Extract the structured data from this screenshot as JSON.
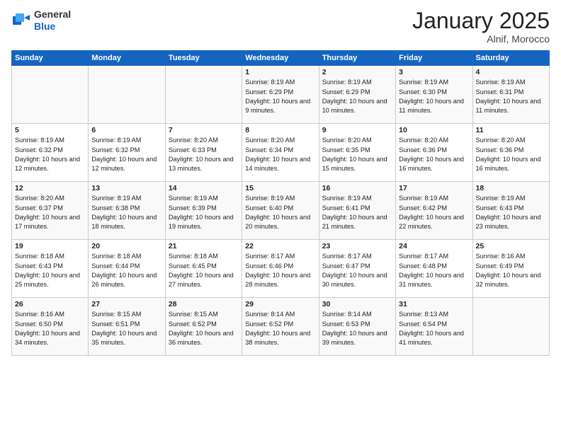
{
  "header": {
    "logo_general": "General",
    "logo_blue": "Blue",
    "month_title": "January 2025",
    "location": "Alnif, Morocco"
  },
  "days_of_week": [
    "Sunday",
    "Monday",
    "Tuesday",
    "Wednesday",
    "Thursday",
    "Friday",
    "Saturday"
  ],
  "weeks": [
    [
      {
        "day": "",
        "info": ""
      },
      {
        "day": "",
        "info": ""
      },
      {
        "day": "",
        "info": ""
      },
      {
        "day": "1",
        "info": "Sunrise: 8:19 AM\nSunset: 6:29 PM\nDaylight: 10 hours and 9 minutes."
      },
      {
        "day": "2",
        "info": "Sunrise: 8:19 AM\nSunset: 6:29 PM\nDaylight: 10 hours and 10 minutes."
      },
      {
        "day": "3",
        "info": "Sunrise: 8:19 AM\nSunset: 6:30 PM\nDaylight: 10 hours and 11 minutes."
      },
      {
        "day": "4",
        "info": "Sunrise: 8:19 AM\nSunset: 6:31 PM\nDaylight: 10 hours and 11 minutes."
      }
    ],
    [
      {
        "day": "5",
        "info": "Sunrise: 8:19 AM\nSunset: 6:32 PM\nDaylight: 10 hours and 12 minutes."
      },
      {
        "day": "6",
        "info": "Sunrise: 8:19 AM\nSunset: 6:32 PM\nDaylight: 10 hours and 12 minutes."
      },
      {
        "day": "7",
        "info": "Sunrise: 8:20 AM\nSunset: 6:33 PM\nDaylight: 10 hours and 13 minutes."
      },
      {
        "day": "8",
        "info": "Sunrise: 8:20 AM\nSunset: 6:34 PM\nDaylight: 10 hours and 14 minutes."
      },
      {
        "day": "9",
        "info": "Sunrise: 8:20 AM\nSunset: 6:35 PM\nDaylight: 10 hours and 15 minutes."
      },
      {
        "day": "10",
        "info": "Sunrise: 8:20 AM\nSunset: 6:36 PM\nDaylight: 10 hours and 16 minutes."
      },
      {
        "day": "11",
        "info": "Sunrise: 8:20 AM\nSunset: 6:36 PM\nDaylight: 10 hours and 16 minutes."
      }
    ],
    [
      {
        "day": "12",
        "info": "Sunrise: 8:20 AM\nSunset: 6:37 PM\nDaylight: 10 hours and 17 minutes."
      },
      {
        "day": "13",
        "info": "Sunrise: 8:19 AM\nSunset: 6:38 PM\nDaylight: 10 hours and 18 minutes."
      },
      {
        "day": "14",
        "info": "Sunrise: 8:19 AM\nSunset: 6:39 PM\nDaylight: 10 hours and 19 minutes."
      },
      {
        "day": "15",
        "info": "Sunrise: 8:19 AM\nSunset: 6:40 PM\nDaylight: 10 hours and 20 minutes."
      },
      {
        "day": "16",
        "info": "Sunrise: 8:19 AM\nSunset: 6:41 PM\nDaylight: 10 hours and 21 minutes."
      },
      {
        "day": "17",
        "info": "Sunrise: 8:19 AM\nSunset: 6:42 PM\nDaylight: 10 hours and 22 minutes."
      },
      {
        "day": "18",
        "info": "Sunrise: 8:19 AM\nSunset: 6:43 PM\nDaylight: 10 hours and 23 minutes."
      }
    ],
    [
      {
        "day": "19",
        "info": "Sunrise: 8:18 AM\nSunset: 6:43 PM\nDaylight: 10 hours and 25 minutes."
      },
      {
        "day": "20",
        "info": "Sunrise: 8:18 AM\nSunset: 6:44 PM\nDaylight: 10 hours and 26 minutes."
      },
      {
        "day": "21",
        "info": "Sunrise: 8:18 AM\nSunset: 6:45 PM\nDaylight: 10 hours and 27 minutes."
      },
      {
        "day": "22",
        "info": "Sunrise: 8:17 AM\nSunset: 6:46 PM\nDaylight: 10 hours and 28 minutes."
      },
      {
        "day": "23",
        "info": "Sunrise: 8:17 AM\nSunset: 6:47 PM\nDaylight: 10 hours and 30 minutes."
      },
      {
        "day": "24",
        "info": "Sunrise: 8:17 AM\nSunset: 6:48 PM\nDaylight: 10 hours and 31 minutes."
      },
      {
        "day": "25",
        "info": "Sunrise: 8:16 AM\nSunset: 6:49 PM\nDaylight: 10 hours and 32 minutes."
      }
    ],
    [
      {
        "day": "26",
        "info": "Sunrise: 8:16 AM\nSunset: 6:50 PM\nDaylight: 10 hours and 34 minutes."
      },
      {
        "day": "27",
        "info": "Sunrise: 8:15 AM\nSunset: 6:51 PM\nDaylight: 10 hours and 35 minutes."
      },
      {
        "day": "28",
        "info": "Sunrise: 8:15 AM\nSunset: 6:52 PM\nDaylight: 10 hours and 36 minutes."
      },
      {
        "day": "29",
        "info": "Sunrise: 8:14 AM\nSunset: 6:52 PM\nDaylight: 10 hours and 38 minutes."
      },
      {
        "day": "30",
        "info": "Sunrise: 8:14 AM\nSunset: 6:53 PM\nDaylight: 10 hours and 39 minutes."
      },
      {
        "day": "31",
        "info": "Sunrise: 8:13 AM\nSunset: 6:54 PM\nDaylight: 10 hours and 41 minutes."
      },
      {
        "day": "",
        "info": ""
      }
    ]
  ]
}
